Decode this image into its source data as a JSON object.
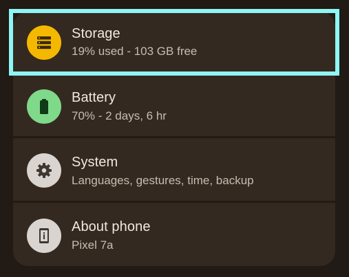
{
  "settings": {
    "items": [
      {
        "title": "Storage",
        "subtitle": "19% used - 103 GB free",
        "icon": "storage-icon",
        "icon_bg": "#f5b800"
      },
      {
        "title": "Battery",
        "subtitle": "70% - 2 days, 6 hr",
        "icon": "battery-icon",
        "icon_bg": "#7fd98a"
      },
      {
        "title": "System",
        "subtitle": "Languages, gestures, time, backup",
        "icon": "gear-icon",
        "icon_bg": "#d9d4cf"
      },
      {
        "title": "About phone",
        "subtitle": "Pixel 7a",
        "icon": "info-phone-icon",
        "icon_bg": "#d9d4cf"
      }
    ]
  },
  "colors": {
    "highlight": "#8ef6f4",
    "background": "#221a14",
    "card": "#342920"
  }
}
